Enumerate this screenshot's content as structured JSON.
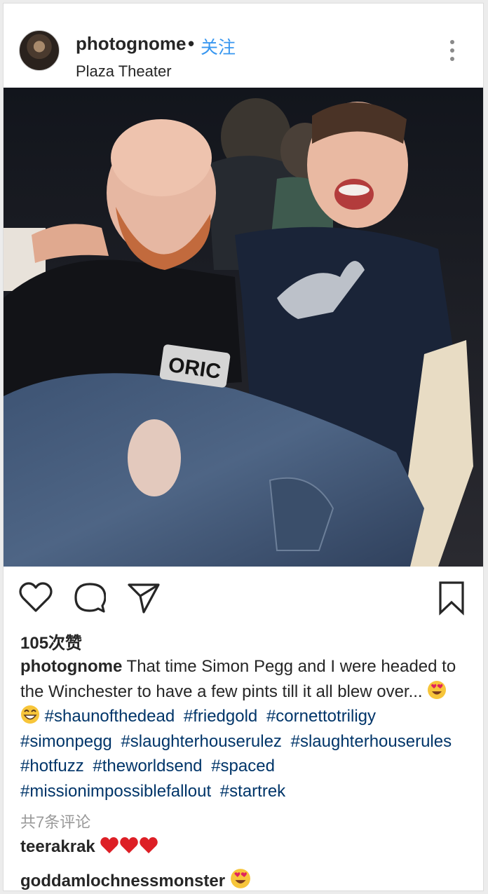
{
  "post": {
    "username": "photognome",
    "separator": "•",
    "follow_label": "关注",
    "location": "Plaza Theater",
    "more_icon": "more-vertical-icon",
    "likes": "105次赞",
    "caption_user": "photognome",
    "caption_text": "That time Simon Pegg and I were headed to the Winchester to have a few pints till it all blew over...",
    "caption_emoji": [
      "heart-eyes-emoji",
      "grinning-emoji"
    ],
    "hashtags": [
      "#shaunofthedead",
      "#friedgold",
      "#cornettotriligy",
      "#simonpegg",
      "#slaughterhouserulez",
      "#slaughterhouserules",
      "#hotfuzz",
      "#theworldsend",
      "#spaced",
      "#missionimpossiblefallout",
      "#startrek"
    ],
    "view_comments": "共7条评论",
    "comments": [
      {
        "user": "teerakrak",
        "emoji": [
          "red-heart",
          "red-heart",
          "red-heart"
        ]
      },
      {
        "user": "goddamlochnessmonster",
        "emoji": [
          "heart-eyes-emoji"
        ]
      }
    ],
    "photo_text": "ORIC"
  },
  "actions": {
    "like_icon": "heart-icon",
    "comment_icon": "comment-icon",
    "share_icon": "send-icon",
    "save_icon": "bookmark-icon"
  },
  "colors": {
    "link": "#3897f0",
    "hashtag": "#003569",
    "muted": "#999999",
    "text": "#262626"
  }
}
